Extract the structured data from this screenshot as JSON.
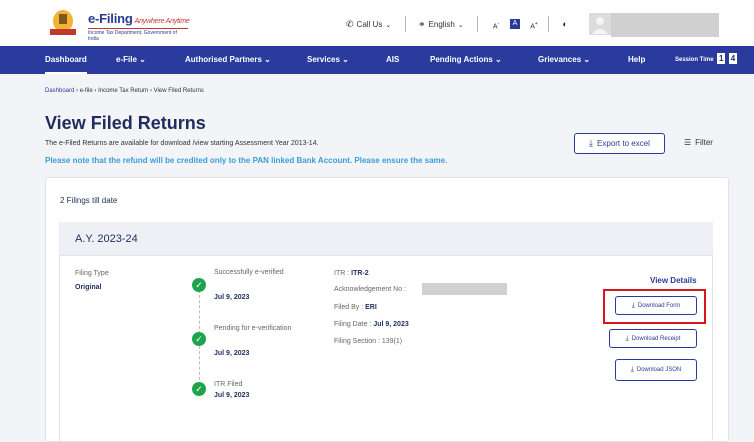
{
  "header": {
    "logo_title": "e-Filing",
    "logo_tagline": "Anywhere Anytime",
    "logo_subtitle": "Income Tax Department, Government of India",
    "call_us": "Call Us",
    "language": "English",
    "font_decrease": "A",
    "font_normal": "A",
    "font_increase": "A"
  },
  "nav": {
    "items": [
      "Dashboard",
      "e-File",
      "Authorised Partners",
      "Services",
      "AIS",
      "Pending Actions",
      "Grievances",
      "Help"
    ],
    "session_label": "Session Time",
    "session_digits": [
      "1",
      "4"
    ]
  },
  "breadcrumb": [
    "Dashboard",
    "e-file",
    "Income Tax Return",
    "View Filed Returns"
  ],
  "page": {
    "title": "View Filed Returns",
    "description": "The e-Filed Returns are available for download /view starting Assessment Year 2013-14.",
    "note": "Please note that the refund will be credited only to the PAN linked Bank Account. Please ensure the same.",
    "export_label": "Export to excel",
    "filter_label": "Filter"
  },
  "filings": {
    "count_text": "2 Filings till date",
    "ay_title": "A.Y. 2023-24",
    "filing_type_label": "Filing Type",
    "filing_type_value": "Original",
    "timeline": [
      {
        "status": "Successfully e-verified",
        "date": "Jul 9, 2023"
      },
      {
        "status": "Pending for e-verification",
        "date": "Jul 9, 2023"
      },
      {
        "status": "ITR Filed",
        "date": "Jul 9, 2023"
      }
    ],
    "itr_label": "ITR :",
    "itr_value": "ITR-2",
    "ack_label": "Acknowledgement No :",
    "filed_by_label": "Filed By :",
    "filed_by_value": "ERI",
    "filing_date_label": "Filing Date :",
    "filing_date_value": "Jul 9, 2023",
    "filing_section_label": "Filing Section :",
    "filing_section_value": "139(1)",
    "view_details": "View Details",
    "download_form": "Download Form",
    "download_receipt": "Download Receipt",
    "download_json": "Download JSON"
  },
  "colors": {
    "nav_bg": "#2a3b9d",
    "accent": "#2a3b9d",
    "note_blue": "#3c9cd7",
    "success_green": "#1ea54c",
    "highlight_red": "#d7141f"
  }
}
